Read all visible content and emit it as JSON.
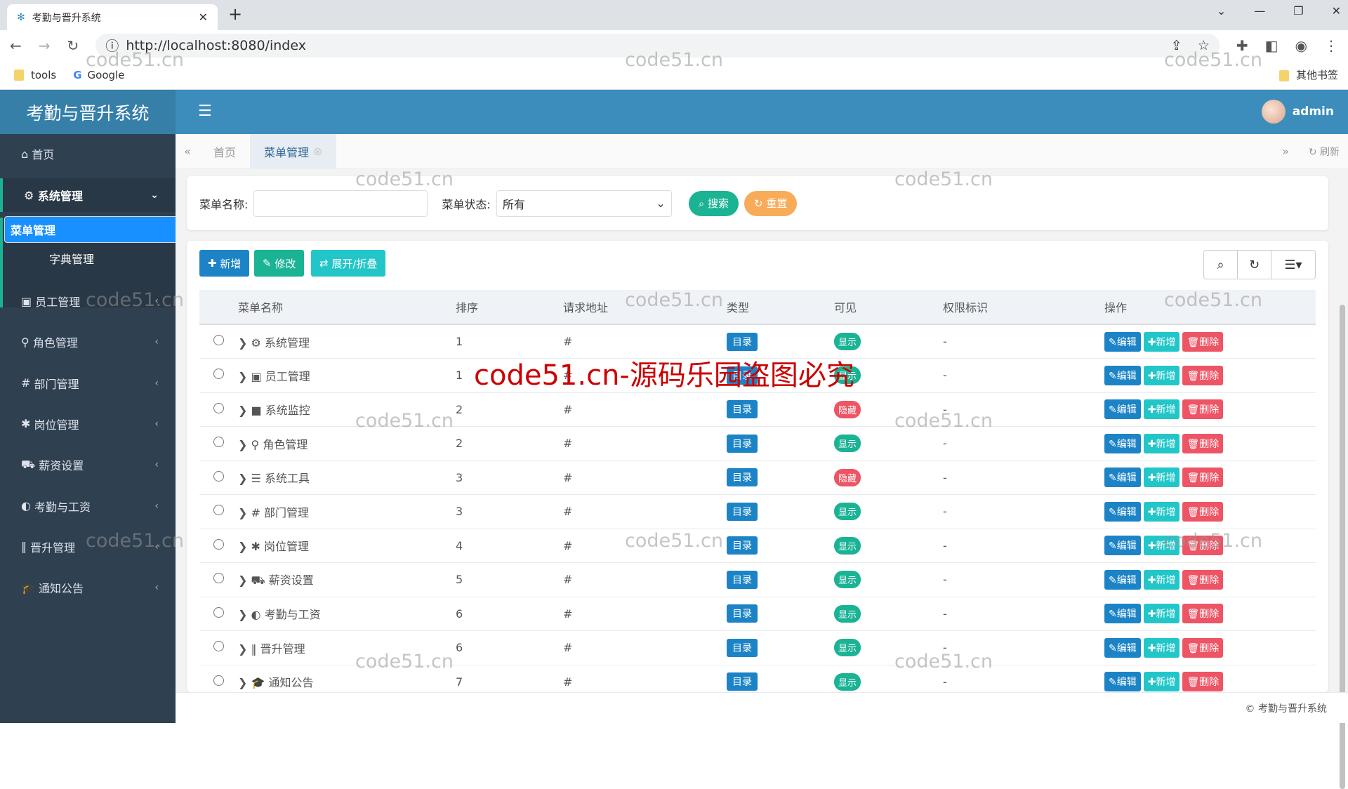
{
  "browser": {
    "tab_title": "考勤与晋升系统",
    "url": "http://localhost:8080/index",
    "bookmarks": [
      "tools",
      "Google"
    ],
    "other_bookmarks": "其他书签"
  },
  "app": {
    "title": "考勤与晋升系统",
    "user": "admin",
    "footer": "© 考勤与晋升系统"
  },
  "sidebar": {
    "home": "首页",
    "system": "系统管理",
    "sub": [
      "菜单管理",
      "字典管理"
    ],
    "items": [
      "员工管理",
      "角色管理",
      "部门管理",
      "岗位管理",
      "薪资设置",
      "考勤与工资",
      "晋升管理",
      "通知公告"
    ]
  },
  "tabs": {
    "home": "首页",
    "active": "菜单管理",
    "refresh": "刷新"
  },
  "search": {
    "name_label": "菜单名称:",
    "name_value": "",
    "status_label": "菜单状态:",
    "status_value": "所有",
    "search_btn": "搜索",
    "reset_btn": "重置"
  },
  "toolbar": {
    "add": "新增",
    "edit": "修改",
    "toggle": "展开/折叠"
  },
  "table": {
    "headers": [
      "菜单名称",
      "排序",
      "请求地址",
      "类型",
      "可见",
      "权限标识",
      "操作"
    ],
    "rows": [
      {
        "icon": "⚙",
        "name": "系统管理",
        "order": "1",
        "url": "#",
        "type": "目录",
        "visible": "显示",
        "perm": "-"
      },
      {
        "icon": "▣",
        "name": "员工管理",
        "order": "1",
        "url": "#",
        "type": "目录",
        "visible": "显示",
        "perm": "-"
      },
      {
        "icon": "■",
        "name": "系统监控",
        "order": "2",
        "url": "#",
        "type": "目录",
        "visible": "隐藏",
        "perm": "-"
      },
      {
        "icon": "⚲",
        "name": "角色管理",
        "order": "2",
        "url": "#",
        "type": "目录",
        "visible": "显示",
        "perm": "-"
      },
      {
        "icon": "☰",
        "name": "系统工具",
        "order": "3",
        "url": "#",
        "type": "目录",
        "visible": "隐藏",
        "perm": "-"
      },
      {
        "icon": "#",
        "name": "部门管理",
        "order": "3",
        "url": "#",
        "type": "目录",
        "visible": "显示",
        "perm": "-"
      },
      {
        "icon": "✱",
        "name": "岗位管理",
        "order": "4",
        "url": "#",
        "type": "目录",
        "visible": "显示",
        "perm": "-"
      },
      {
        "icon": "⛟",
        "name": "薪资设置",
        "order": "5",
        "url": "#",
        "type": "目录",
        "visible": "显示",
        "perm": "-"
      },
      {
        "icon": "◐",
        "name": "考勤与工资",
        "order": "6",
        "url": "#",
        "type": "目录",
        "visible": "显示",
        "perm": "-"
      },
      {
        "icon": "‖",
        "name": "晋升管理",
        "order": "6",
        "url": "#",
        "type": "目录",
        "visible": "显示",
        "perm": "-"
      },
      {
        "icon": "🎓",
        "name": "通知公告",
        "order": "7",
        "url": "#",
        "type": "目录",
        "visible": "显示",
        "perm": "-"
      }
    ],
    "ops": [
      "编辑",
      "新增",
      "删除"
    ]
  },
  "colors": {
    "primary": "#3c8dbc",
    "sidebar": "#2f4050",
    "green": "#1ab394",
    "orange": "#f8ac59",
    "cyan": "#23c6c8",
    "red": "#ed5565",
    "blue": "#1c84c6"
  },
  "watermark": "code51.cn",
  "warning": "code51.cn-源码乐园盗图必究"
}
